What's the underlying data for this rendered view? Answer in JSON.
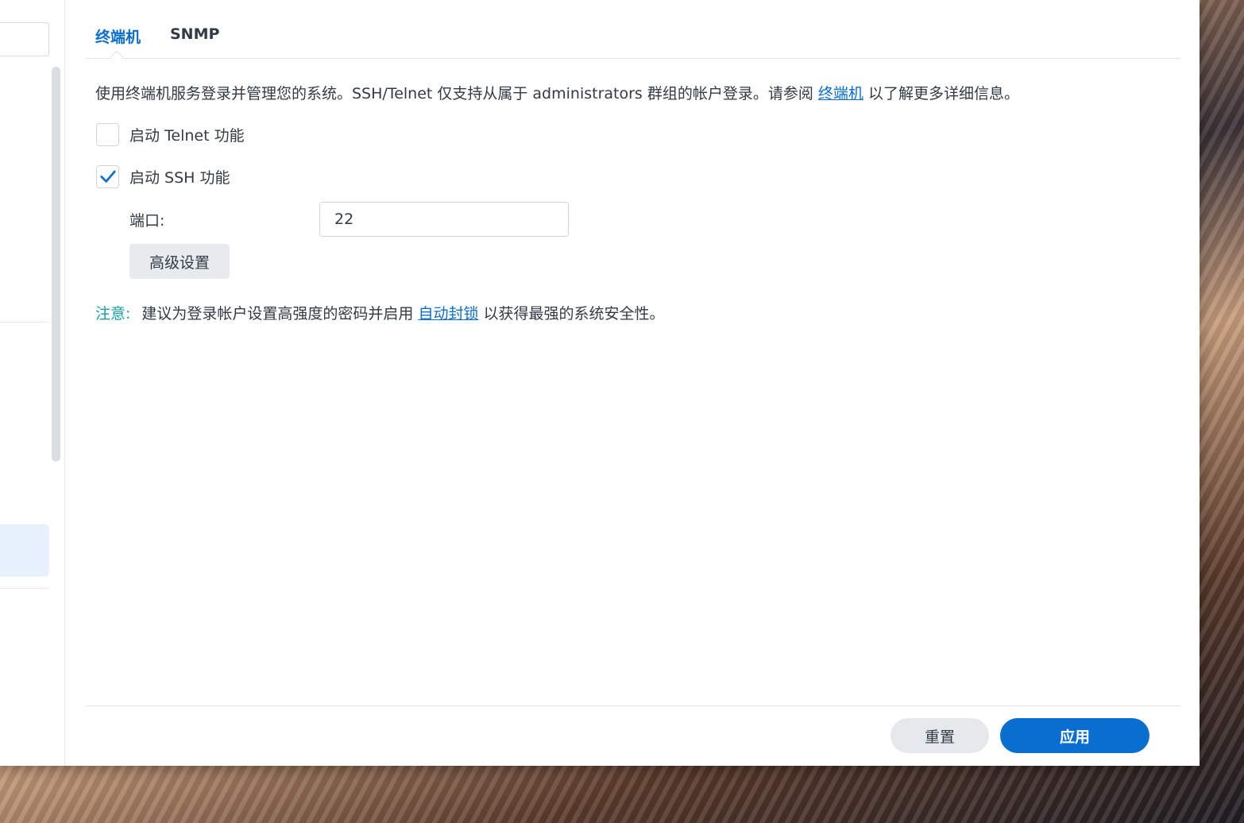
{
  "tabs": [
    {
      "label": "终端机",
      "active": true
    },
    {
      "label": "SNMP",
      "active": false
    }
  ],
  "description": {
    "before": "使用终端机服务登录并管理您的系统。SSH/Telnet 仅支持从属于 administrators 群组的帐户登录。请参阅 ",
    "link": "终端机",
    "after": " 以了解更多详细信息。"
  },
  "telnet": {
    "label": "启动 Telnet 功能",
    "checked": false
  },
  "ssh": {
    "label": "启动 SSH 功能",
    "checked": true
  },
  "port": {
    "label": "端口:",
    "value": "22"
  },
  "advanced_button": "高级设置",
  "note": {
    "label": "注意:",
    "before": "建议为登录帐户设置高强度的密码并启用 ",
    "link": "自动封锁",
    "after": " 以获得最强的系统安全性。"
  },
  "footer": {
    "reset_label": "重置",
    "apply_label": "应用"
  },
  "colors": {
    "accent": "#0a6ed1",
    "note": "#14a3a3"
  },
  "icons": {
    "checkmark": "checkmark-icon"
  }
}
